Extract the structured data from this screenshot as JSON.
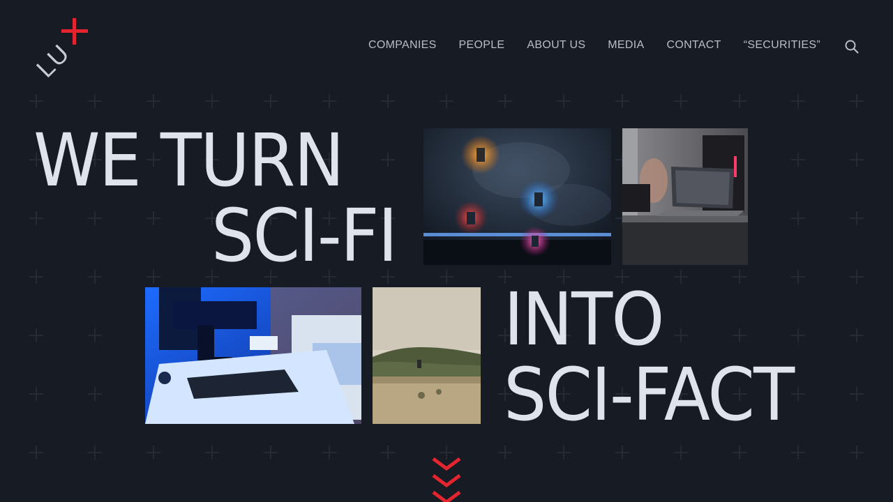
{
  "brand": {
    "logo_text": "LU",
    "accent_color": "#e4252f",
    "background_color": "#171b24"
  },
  "nav": {
    "items": [
      {
        "label": "COMPANIES"
      },
      {
        "label": "PEOPLE"
      },
      {
        "label": "ABOUT US"
      },
      {
        "label": "MEDIA"
      },
      {
        "label": "CONTACT"
      },
      {
        "label": "“SECURITIES”"
      }
    ],
    "search_icon": "search-icon"
  },
  "hero": {
    "line1": "WE TURN",
    "line2": "SCI-FI",
    "line3": "INTO",
    "line4": "SCI-FACT"
  },
  "media": {
    "photos": [
      {
        "name": "drones-photo"
      },
      {
        "name": "laptop-photo"
      },
      {
        "name": "microscope-photo"
      },
      {
        "name": "field-photo"
      }
    ]
  },
  "scroll": {
    "icon": "chevron-down-icon"
  }
}
